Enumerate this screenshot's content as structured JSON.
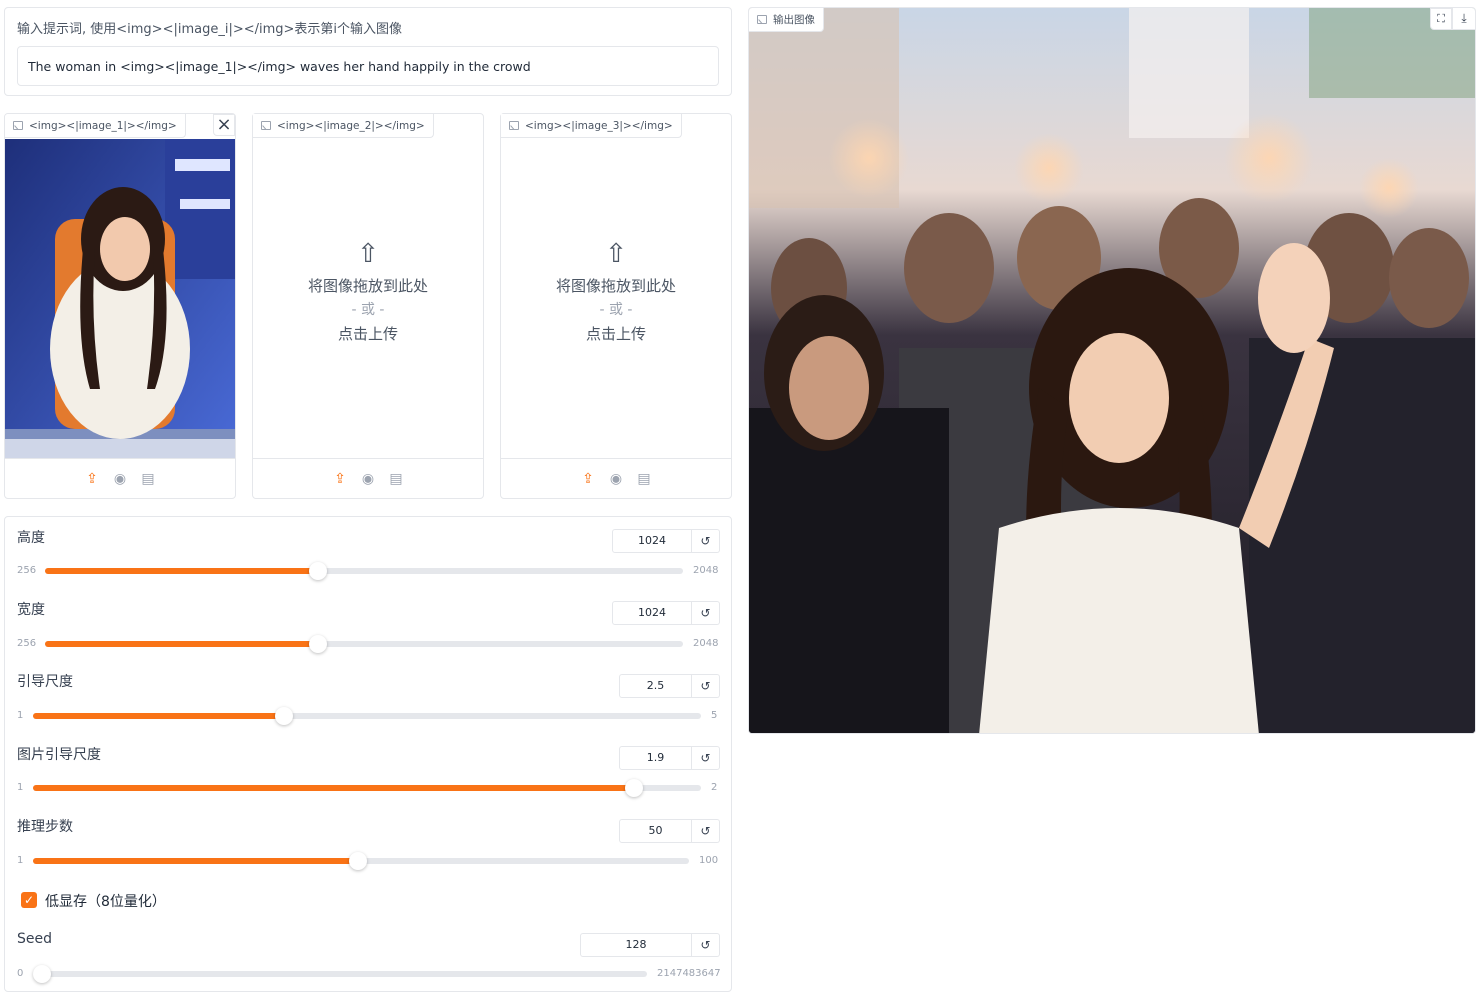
{
  "prompt": {
    "label": "输入提示词, 使用<img><|image_i|></img>表示第i个输入图像",
    "value": "The woman in <img><|image_1|></img> waves her hand happily in the crowd"
  },
  "inputs": [
    {
      "tag": "<img><|image_1|></img>"
    },
    {
      "tag": "<img><|image_2|></img>",
      "drop_text": "将图像拖放到此处",
      "or_text": "- 或 -",
      "click_text": "点击上传"
    },
    {
      "tag": "<img><|image_3|></img>",
      "drop_text": "将图像拖放到此处",
      "or_text": "- 或 -",
      "click_text": "点击上传"
    }
  ],
  "icons": {
    "upload": "upload-icon",
    "camera": "webcam-icon",
    "clipboard": "clipboard-icon",
    "close": "close-icon",
    "reset": "reset-icon",
    "fullscreen": "fullscreen-icon",
    "download": "download-icon"
  },
  "sliders": [
    {
      "label": "高度",
      "value": "1024",
      "min": "256",
      "max": "2048",
      "fraction": 0.4286
    },
    {
      "label": "宽度",
      "value": "1024",
      "min": "256",
      "max": "2048",
      "fraction": 0.4286
    },
    {
      "label": "引导尺度",
      "value": "2.5",
      "min": "1",
      "max": "5",
      "fraction": 0.375
    },
    {
      "label": "图片引导尺度",
      "value": "1.9",
      "min": "1",
      "max": "2",
      "fraction": 0.9
    },
    {
      "label": "推理步数",
      "value": "50",
      "min": "1",
      "max": "100",
      "fraction": 0.495
    },
    {
      "label": "Seed",
      "value": "128",
      "min": "0",
      "max": "2147483647",
      "fraction": 0.0
    }
  ],
  "low_vram": {
    "label": "低显存（8位量化）",
    "checked": true
  },
  "output": {
    "label": "输出图像"
  },
  "colors": {
    "accent": "#f97316",
    "border": "#e5e7eb"
  }
}
